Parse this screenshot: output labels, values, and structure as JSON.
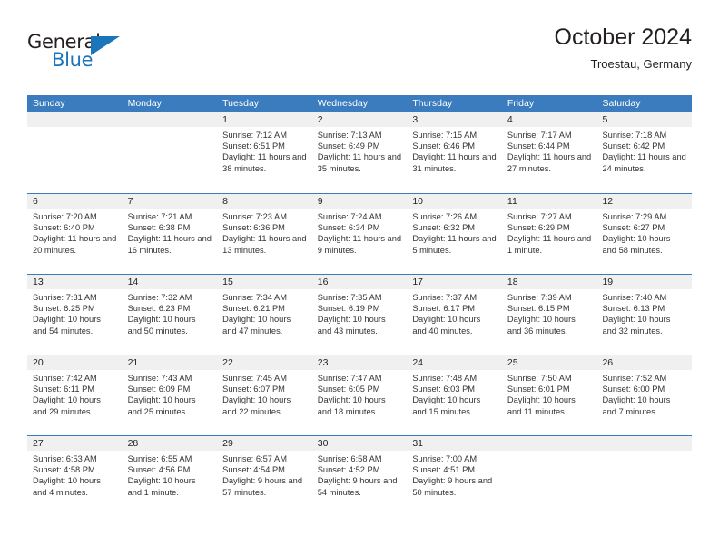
{
  "brand": {
    "name_part1": "General",
    "name_part2": "Blue",
    "logo_icon": "triangle-logo-icon"
  },
  "header": {
    "title": "October 2024",
    "location": "Troestau, Germany"
  },
  "calendar": {
    "weekdays": [
      "Sunday",
      "Monday",
      "Tuesday",
      "Wednesday",
      "Thursday",
      "Friday",
      "Saturday"
    ],
    "accent_color": "#3a7cbe",
    "day_band_color": "#f0f0f0",
    "weeks": [
      [
        {
          "date": "",
          "sunrise": "",
          "sunset": "",
          "daylight": "",
          "empty": true
        },
        {
          "date": "",
          "sunrise": "",
          "sunset": "",
          "daylight": "",
          "empty": true
        },
        {
          "date": "1",
          "sunrise": "Sunrise: 7:12 AM",
          "sunset": "Sunset: 6:51 PM",
          "daylight": "Daylight: 11 hours and 38 minutes."
        },
        {
          "date": "2",
          "sunrise": "Sunrise: 7:13 AM",
          "sunset": "Sunset: 6:49 PM",
          "daylight": "Daylight: 11 hours and 35 minutes."
        },
        {
          "date": "3",
          "sunrise": "Sunrise: 7:15 AM",
          "sunset": "Sunset: 6:46 PM",
          "daylight": "Daylight: 11 hours and 31 minutes."
        },
        {
          "date": "4",
          "sunrise": "Sunrise: 7:17 AM",
          "sunset": "Sunset: 6:44 PM",
          "daylight": "Daylight: 11 hours and 27 minutes."
        },
        {
          "date": "5",
          "sunrise": "Sunrise: 7:18 AM",
          "sunset": "Sunset: 6:42 PM",
          "daylight": "Daylight: 11 hours and 24 minutes."
        }
      ],
      [
        {
          "date": "6",
          "sunrise": "Sunrise: 7:20 AM",
          "sunset": "Sunset: 6:40 PM",
          "daylight": "Daylight: 11 hours and 20 minutes."
        },
        {
          "date": "7",
          "sunrise": "Sunrise: 7:21 AM",
          "sunset": "Sunset: 6:38 PM",
          "daylight": "Daylight: 11 hours and 16 minutes."
        },
        {
          "date": "8",
          "sunrise": "Sunrise: 7:23 AM",
          "sunset": "Sunset: 6:36 PM",
          "daylight": "Daylight: 11 hours and 13 minutes."
        },
        {
          "date": "9",
          "sunrise": "Sunrise: 7:24 AM",
          "sunset": "Sunset: 6:34 PM",
          "daylight": "Daylight: 11 hours and 9 minutes."
        },
        {
          "date": "10",
          "sunrise": "Sunrise: 7:26 AM",
          "sunset": "Sunset: 6:32 PM",
          "daylight": "Daylight: 11 hours and 5 minutes."
        },
        {
          "date": "11",
          "sunrise": "Sunrise: 7:27 AM",
          "sunset": "Sunset: 6:29 PM",
          "daylight": "Daylight: 11 hours and 1 minute."
        },
        {
          "date": "12",
          "sunrise": "Sunrise: 7:29 AM",
          "sunset": "Sunset: 6:27 PM",
          "daylight": "Daylight: 10 hours and 58 minutes."
        }
      ],
      [
        {
          "date": "13",
          "sunrise": "Sunrise: 7:31 AM",
          "sunset": "Sunset: 6:25 PM",
          "daylight": "Daylight: 10 hours and 54 minutes."
        },
        {
          "date": "14",
          "sunrise": "Sunrise: 7:32 AM",
          "sunset": "Sunset: 6:23 PM",
          "daylight": "Daylight: 10 hours and 50 minutes."
        },
        {
          "date": "15",
          "sunrise": "Sunrise: 7:34 AM",
          "sunset": "Sunset: 6:21 PM",
          "daylight": "Daylight: 10 hours and 47 minutes."
        },
        {
          "date": "16",
          "sunrise": "Sunrise: 7:35 AM",
          "sunset": "Sunset: 6:19 PM",
          "daylight": "Daylight: 10 hours and 43 minutes."
        },
        {
          "date": "17",
          "sunrise": "Sunrise: 7:37 AM",
          "sunset": "Sunset: 6:17 PM",
          "daylight": "Daylight: 10 hours and 40 minutes."
        },
        {
          "date": "18",
          "sunrise": "Sunrise: 7:39 AM",
          "sunset": "Sunset: 6:15 PM",
          "daylight": "Daylight: 10 hours and 36 minutes."
        },
        {
          "date": "19",
          "sunrise": "Sunrise: 7:40 AM",
          "sunset": "Sunset: 6:13 PM",
          "daylight": "Daylight: 10 hours and 32 minutes."
        }
      ],
      [
        {
          "date": "20",
          "sunrise": "Sunrise: 7:42 AM",
          "sunset": "Sunset: 6:11 PM",
          "daylight": "Daylight: 10 hours and 29 minutes."
        },
        {
          "date": "21",
          "sunrise": "Sunrise: 7:43 AM",
          "sunset": "Sunset: 6:09 PM",
          "daylight": "Daylight: 10 hours and 25 minutes."
        },
        {
          "date": "22",
          "sunrise": "Sunrise: 7:45 AM",
          "sunset": "Sunset: 6:07 PM",
          "daylight": "Daylight: 10 hours and 22 minutes."
        },
        {
          "date": "23",
          "sunrise": "Sunrise: 7:47 AM",
          "sunset": "Sunset: 6:05 PM",
          "daylight": "Daylight: 10 hours and 18 minutes."
        },
        {
          "date": "24",
          "sunrise": "Sunrise: 7:48 AM",
          "sunset": "Sunset: 6:03 PM",
          "daylight": "Daylight: 10 hours and 15 minutes."
        },
        {
          "date": "25",
          "sunrise": "Sunrise: 7:50 AM",
          "sunset": "Sunset: 6:01 PM",
          "daylight": "Daylight: 10 hours and 11 minutes."
        },
        {
          "date": "26",
          "sunrise": "Sunrise: 7:52 AM",
          "sunset": "Sunset: 6:00 PM",
          "daylight": "Daylight: 10 hours and 7 minutes."
        }
      ],
      [
        {
          "date": "27",
          "sunrise": "Sunrise: 6:53 AM",
          "sunset": "Sunset: 4:58 PM",
          "daylight": "Daylight: 10 hours and 4 minutes."
        },
        {
          "date": "28",
          "sunrise": "Sunrise: 6:55 AM",
          "sunset": "Sunset: 4:56 PM",
          "daylight": "Daylight: 10 hours and 1 minute."
        },
        {
          "date": "29",
          "sunrise": "Sunrise: 6:57 AM",
          "sunset": "Sunset: 4:54 PM",
          "daylight": "Daylight: 9 hours and 57 minutes."
        },
        {
          "date": "30",
          "sunrise": "Sunrise: 6:58 AM",
          "sunset": "Sunset: 4:52 PM",
          "daylight": "Daylight: 9 hours and 54 minutes."
        },
        {
          "date": "31",
          "sunrise": "Sunrise: 7:00 AM",
          "sunset": "Sunset: 4:51 PM",
          "daylight": "Daylight: 9 hours and 50 minutes."
        },
        {
          "date": "",
          "sunrise": "",
          "sunset": "",
          "daylight": "",
          "empty": true
        },
        {
          "date": "",
          "sunrise": "",
          "sunset": "",
          "daylight": "",
          "empty": true
        }
      ]
    ]
  }
}
